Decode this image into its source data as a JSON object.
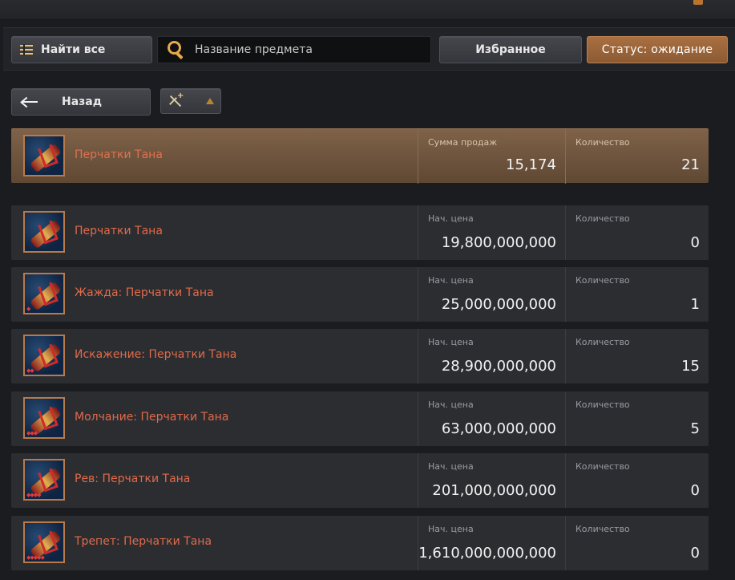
{
  "toolbar": {
    "find_all_label": "Найти все",
    "search_placeholder": "Название предмета",
    "favorites_label": "Избранное",
    "status_label": "Статус: ожидание"
  },
  "nav": {
    "back_label": "Назад"
  },
  "summary": {
    "item_name": "Перчатки Тана",
    "sales_label": "Сумма продаж",
    "sales_value": "15,174",
    "qty_label": "Количество",
    "qty_value": "21"
  },
  "listings": [
    {
      "name": "Перчатки Тана",
      "price_label": "Нач. цена",
      "price": "19,800,000,000",
      "qty_label": "Количество",
      "qty": "0",
      "enhance": ""
    },
    {
      "name": "Жажда: Перчатки Тана",
      "price_label": "Нач. цена",
      "price": "25,000,000,000",
      "qty_label": "Количество",
      "qty": "1",
      "enhance": "◆"
    },
    {
      "name": "Искажение: Перчатки Тана",
      "price_label": "Нач. цена",
      "price": "28,900,000,000",
      "qty_label": "Количество",
      "qty": "15",
      "enhance": "◆◆"
    },
    {
      "name": "Молчание: Перчатки Тана",
      "price_label": "Нач. цена",
      "price": "63,000,000,000",
      "qty_label": "Количество",
      "qty": "5",
      "enhance": "◆◆◆"
    },
    {
      "name": "Рев: Перчатки Тана",
      "price_label": "Нач. цена",
      "price": "201,000,000,000",
      "qty_label": "Количество",
      "qty": "0",
      "enhance": "◆◆◆◆"
    },
    {
      "name": "Трепет: Перчатки Тана",
      "price_label": "Нач. цена",
      "price": "1,610,000,000,000",
      "qty_label": "Количество",
      "qty": "0",
      "enhance": "◆◆◆◆◆"
    }
  ],
  "colors": {
    "accent": "#a97041",
    "item_name": "#e06a4a"
  }
}
